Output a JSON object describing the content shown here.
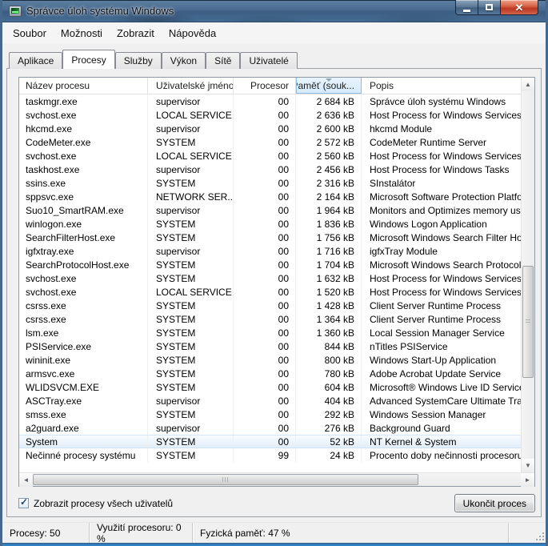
{
  "window": {
    "title": "Správce úloh systému Windows",
    "app_icon": "taskmanager-icon",
    "buttons": {
      "minimize": "minimize",
      "maximize": "maximize",
      "close": "close"
    }
  },
  "colors": {
    "titlebar_glass": "#4a6b8f",
    "close_button_red": "#bc3722",
    "frame_blue": "#46688c",
    "sorted_header_bg": "#d6eafb",
    "sorted_header_border": "#8ebde6",
    "selected_row_bg": "#e2eef9",
    "dialog_bg": "#f0f0f0"
  },
  "menu": {
    "items": [
      "Soubor",
      "Možnosti",
      "Zobrazit",
      "Nápověda"
    ]
  },
  "tabs": {
    "items": [
      {
        "label": "Aplikace",
        "active": false
      },
      {
        "label": "Procesy",
        "active": true
      },
      {
        "label": "Služby",
        "active": false
      },
      {
        "label": "Výkon",
        "active": false
      },
      {
        "label": "Sítě",
        "active": false
      },
      {
        "label": "Uživatelé",
        "active": false
      }
    ]
  },
  "table": {
    "columns": [
      {
        "label": "Název procesu",
        "align": "left",
        "sorted": false
      },
      {
        "label": "Uživatelské jméno",
        "align": "left",
        "sorted": false
      },
      {
        "label": "Procesor",
        "align": "right",
        "sorted": false
      },
      {
        "label": "Paměť (souk...",
        "align": "right",
        "sorted": true,
        "sort_icon": "sort-descending-icon"
      },
      {
        "label": "Popis",
        "align": "left",
        "sorted": false
      }
    ],
    "rows": [
      {
        "name": "taskmgr.exe",
        "user": "supervisor",
        "cpu": "00",
        "mem": "2 684 kB",
        "desc": "Správce úloh systému Windows",
        "selected": false
      },
      {
        "name": "svchost.exe",
        "user": "LOCAL SERVICE",
        "cpu": "00",
        "mem": "2 636 kB",
        "desc": "Host Process for Windows Services",
        "selected": false
      },
      {
        "name": "hkcmd.exe",
        "user": "supervisor",
        "cpu": "00",
        "mem": "2 600 kB",
        "desc": "hkcmd Module",
        "selected": false
      },
      {
        "name": "CodeMeter.exe",
        "user": "SYSTEM",
        "cpu": "00",
        "mem": "2 572 kB",
        "desc": "CodeMeter Runtime Server",
        "selected": false
      },
      {
        "name": "svchost.exe",
        "user": "LOCAL SERVICE",
        "cpu": "00",
        "mem": "2 560 kB",
        "desc": "Host Process for Windows Services",
        "selected": false
      },
      {
        "name": "taskhost.exe",
        "user": "supervisor",
        "cpu": "00",
        "mem": "2 456 kB",
        "desc": "Host Process for Windows Tasks",
        "selected": false
      },
      {
        "name": "ssins.exe",
        "user": "SYSTEM",
        "cpu": "00",
        "mem": "2 316 kB",
        "desc": "SInstalátor",
        "selected": false
      },
      {
        "name": "sppsvc.exe",
        "user": "NETWORK SER...",
        "cpu": "00",
        "mem": "2 164 kB",
        "desc": "Microsoft Software Protection Platform",
        "selected": false
      },
      {
        "name": "Suo10_SmartRAM.exe",
        "user": "supervisor",
        "cpu": "00",
        "mem": "1 964 kB",
        "desc": "Monitors and Optimizes memory usage f",
        "selected": false
      },
      {
        "name": "winlogon.exe",
        "user": "SYSTEM",
        "cpu": "00",
        "mem": "1 836 kB",
        "desc": "Windows Logon Application",
        "selected": false
      },
      {
        "name": "SearchFilterHost.exe",
        "user": "SYSTEM",
        "cpu": "00",
        "mem": "1 756 kB",
        "desc": "Microsoft Windows Search Filter Host",
        "selected": false
      },
      {
        "name": "igfxtray.exe",
        "user": "supervisor",
        "cpu": "00",
        "mem": "1 716 kB",
        "desc": "igfxTray Module",
        "selected": false
      },
      {
        "name": "SearchProtocolHost.exe",
        "user": "SYSTEM",
        "cpu": "00",
        "mem": "1 704 kB",
        "desc": "Microsoft Windows Search Protocol Host",
        "selected": false
      },
      {
        "name": "svchost.exe",
        "user": "SYSTEM",
        "cpu": "00",
        "mem": "1 632 kB",
        "desc": "Host Process for Windows Services",
        "selected": false
      },
      {
        "name": "svchost.exe",
        "user": "LOCAL SERVICE",
        "cpu": "00",
        "mem": "1 520 kB",
        "desc": "Host Process for Windows Services",
        "selected": false
      },
      {
        "name": "csrss.exe",
        "user": "SYSTEM",
        "cpu": "00",
        "mem": "1 428 kB",
        "desc": "Client Server Runtime Process",
        "selected": false
      },
      {
        "name": "csrss.exe",
        "user": "SYSTEM",
        "cpu": "00",
        "mem": "1 364 kB",
        "desc": "Client Server Runtime Process",
        "selected": false
      },
      {
        "name": "lsm.exe",
        "user": "SYSTEM",
        "cpu": "00",
        "mem": "1 360 kB",
        "desc": "Local Session Manager Service",
        "selected": false
      },
      {
        "name": "PSIService.exe",
        "user": "SYSTEM",
        "cpu": "00",
        "mem": "844 kB",
        "desc": "nTitles PSIService",
        "selected": false
      },
      {
        "name": "wininit.exe",
        "user": "SYSTEM",
        "cpu": "00",
        "mem": "800 kB",
        "desc": "Windows Start-Up Application",
        "selected": false
      },
      {
        "name": "armsvc.exe",
        "user": "SYSTEM",
        "cpu": "00",
        "mem": "780 kB",
        "desc": "Adobe Acrobat Update Service",
        "selected": false
      },
      {
        "name": "WLIDSVCM.EXE",
        "user": "SYSTEM",
        "cpu": "00",
        "mem": "604 kB",
        "desc": "Microsoft® Windows Live ID Service Mo",
        "selected": false
      },
      {
        "name": "ASCTray.exe",
        "user": "supervisor",
        "cpu": "00",
        "mem": "404 kB",
        "desc": "Advanced SystemCare Ultimate Tray",
        "selected": false
      },
      {
        "name": "smss.exe",
        "user": "SYSTEM",
        "cpu": "00",
        "mem": "292 kB",
        "desc": "Windows Session Manager",
        "selected": false
      },
      {
        "name": "a2guard.exe",
        "user": "supervisor",
        "cpu": "00",
        "mem": "276 kB",
        "desc": "Background Guard",
        "selected": false
      },
      {
        "name": "System",
        "user": "SYSTEM",
        "cpu": "00",
        "mem": "52 kB",
        "desc": "NT Kernel & System",
        "selected": true
      },
      {
        "name": "Nečinné procesy systému",
        "user": "SYSTEM",
        "cpu": "99",
        "mem": "24 kB",
        "desc": "Procento doby nečinnosti procesoru",
        "selected": false
      }
    ]
  },
  "scrollbars": {
    "vertical": {
      "up_icon": "scroll-up-icon",
      "down_icon": "scroll-down-icon"
    },
    "horizontal": {
      "left_icon": "scroll-left-icon",
      "right_icon": "scroll-right-icon"
    }
  },
  "footer": {
    "show_all_users_label": "Zobrazit procesy všech uživatelů",
    "show_all_users_checked": true,
    "check_glyph": "✓",
    "end_process_label": "Ukončit proces"
  },
  "statusbar": {
    "processes": "Procesy: 50",
    "cpu_usage": "Využití procesoru: 0 %",
    "physical_memory": "Fyzická paměť: 47 %"
  }
}
